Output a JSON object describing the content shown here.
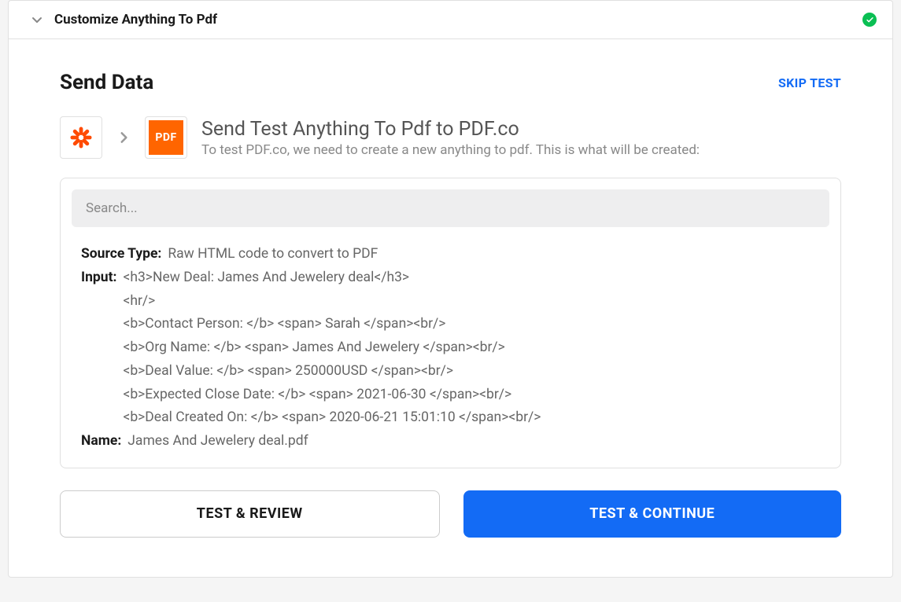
{
  "header": {
    "title": "Customize Anything To Pdf"
  },
  "section": {
    "title": "Send Data",
    "skip_label": "SKIP TEST"
  },
  "flow": {
    "title": "Send Test Anything To Pdf to PDF.co",
    "description": "To test PDF.co, we need to create a new anything to pdf. This is what will be created:",
    "pdf_badge": "PDF"
  },
  "search": {
    "placeholder": "Search..."
  },
  "data": {
    "source_type_label": "Source Type:",
    "source_type_value": "Raw HTML code to convert to PDF",
    "input_label": "Input:",
    "input_lines": [
      "<h3>New Deal: James And Jewelery deal</h3>",
      "<hr/>",
      "<b>Contact Person: </b> <span> Sarah </span><br/>",
      "<b>Org Name: </b> <span> James And Jewelery </span><br/>",
      "<b>Deal Value: </b> <span> 250000USD </span><br/>",
      "<b>Expected Close Date: </b> <span> 2021-06-30 </span><br/>",
      "<b>Deal Created On: </b> <span> 2020-06-21 15:01:10 </span><br/>"
    ],
    "name_label": "Name:",
    "name_value": "James And Jewelery deal.pdf"
  },
  "buttons": {
    "review": "TEST & REVIEW",
    "continue": "TEST & CONTINUE"
  }
}
